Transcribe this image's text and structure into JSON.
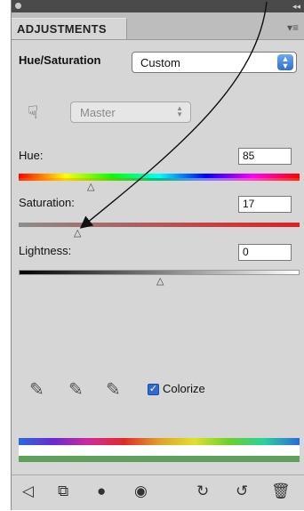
{
  "panel": {
    "tab_label": "ADJUSTMENTS",
    "menu_icon": "panel-menu-icon",
    "title": "Hue/Saturation",
    "preset_value": "Custom",
    "channel_value": "Master"
  },
  "sliders": [
    {
      "label": "Hue:",
      "value": "85"
    },
    {
      "label": "Saturation:",
      "value": "17"
    },
    {
      "label": "Lightness:",
      "value": "0"
    }
  ],
  "colorize": {
    "label": "Colorize",
    "checked": true
  },
  "footer_icons": [
    "back-arrow-icon",
    "clip-to-layer-icon",
    "visibility-mask-icon",
    "eye-icon",
    "view-previous-icon",
    "reset-icon",
    "trash-icon"
  ],
  "colors": {
    "panel_bg": "#d6d6d6",
    "accent": "#2e6bd0"
  }
}
